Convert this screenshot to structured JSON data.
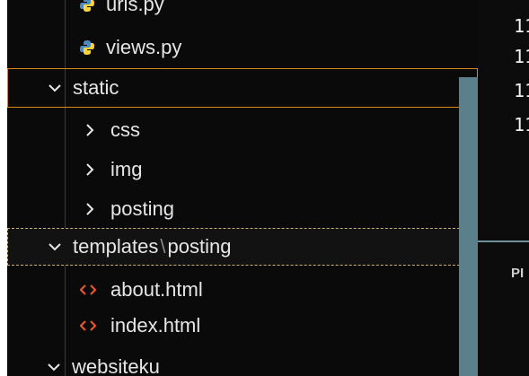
{
  "explorer": {
    "items": [
      {
        "label": "urls.py",
        "icon": "python-file-icon",
        "kind": "file"
      },
      {
        "label": "views.py",
        "icon": "python-file-icon",
        "kind": "file"
      },
      {
        "label": "static",
        "icon": "chevron-down-icon",
        "kind": "folder-open"
      },
      {
        "label": "css",
        "icon": "chevron-right-icon",
        "kind": "folder-closed"
      },
      {
        "label": "img",
        "icon": "chevron-right-icon",
        "kind": "folder-closed"
      },
      {
        "label": "posting",
        "icon": "chevron-right-icon",
        "kind": "folder-closed"
      },
      {
        "label_parts": [
          "templates",
          "\\",
          "posting"
        ],
        "icon": "chevron-down-icon",
        "kind": "folder-open"
      },
      {
        "label": "about.html",
        "icon": "html-file-icon",
        "kind": "file"
      },
      {
        "label": "index.html",
        "icon": "html-file-icon",
        "kind": "file"
      },
      {
        "label": "websiteku",
        "icon": "chevron-down-icon",
        "kind": "folder-open"
      }
    ]
  },
  "editor": {
    "line_numbers": [
      "11",
      "11",
      "11",
      "11"
    ],
    "panel_label": "PI"
  },
  "colors": {
    "background": "#0a0a0a",
    "selection_border": "#d98a1c",
    "focus_border": "#c9b07a",
    "scrollbar": "#5c7f8c",
    "python_icon": "#4b8bbe",
    "html_icon": "#e8562a",
    "text": "#e6e6e6"
  }
}
